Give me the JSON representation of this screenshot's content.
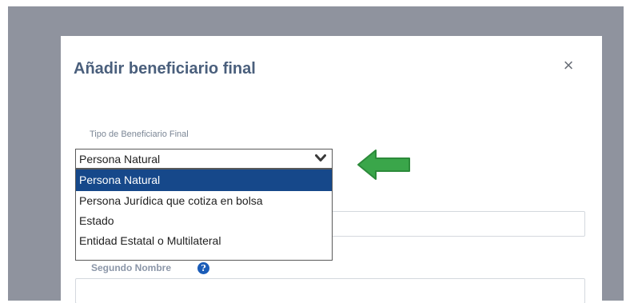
{
  "modal": {
    "title": "Añadir beneficiario final",
    "close_symbol": "×"
  },
  "beneficiary_type": {
    "label": "Tipo de Beneficiario Final",
    "selected_value": "Persona Natural",
    "options": [
      "Persona Natural",
      "Persona Jurídica que cotiza en bolsa",
      "Estado",
      "Entidad Estatal o Multilateral"
    ]
  },
  "second_name": {
    "label": "Segundo Nombre",
    "info_symbol": "?"
  },
  "colors": {
    "backdrop": "#8f939e",
    "title": "#4a5f7c",
    "selected_option_bg": "#16488a",
    "annotation_arrow": "#3aa64a",
    "info_icon": "#1a5cb8"
  },
  "icons": {
    "close": "close-icon",
    "select_arrow": "chevron-down-icon",
    "annotation": "arrow-left-icon",
    "info": "info-icon"
  }
}
